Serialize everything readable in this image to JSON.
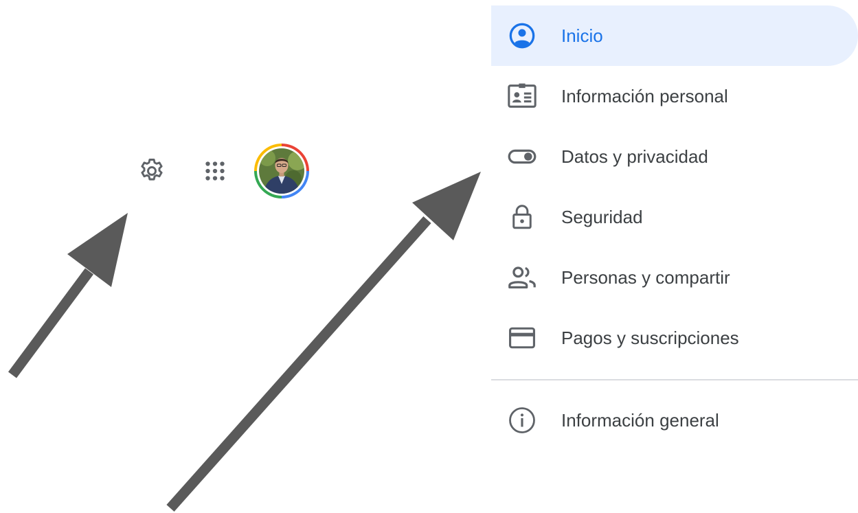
{
  "toolbar": {
    "settings_icon": "gear-icon",
    "apps_icon": "apps-grid-icon",
    "avatar_icon": "avatar"
  },
  "nav": {
    "items": [
      {
        "label": "Inicio",
        "icon": "account-circle-icon",
        "active": true
      },
      {
        "label": "Información personal",
        "icon": "id-card-icon",
        "active": false
      },
      {
        "label": "Datos y privacidad",
        "icon": "toggle-icon",
        "active": false
      },
      {
        "label": "Seguridad",
        "icon": "lock-icon",
        "active": false
      },
      {
        "label": "Personas y compartir",
        "icon": "people-icon",
        "active": false
      },
      {
        "label": "Pagos y suscripciones",
        "icon": "credit-card-icon",
        "active": false
      }
    ],
    "footer_item": {
      "label": "Información general",
      "icon": "info-icon"
    }
  },
  "colors": {
    "accent": "#1a73e8",
    "active_bg": "#e8f0fe",
    "text": "#3c4043",
    "icon": "#5f6368",
    "arrow": "#5a5a5a",
    "divider": "#dadce0"
  }
}
